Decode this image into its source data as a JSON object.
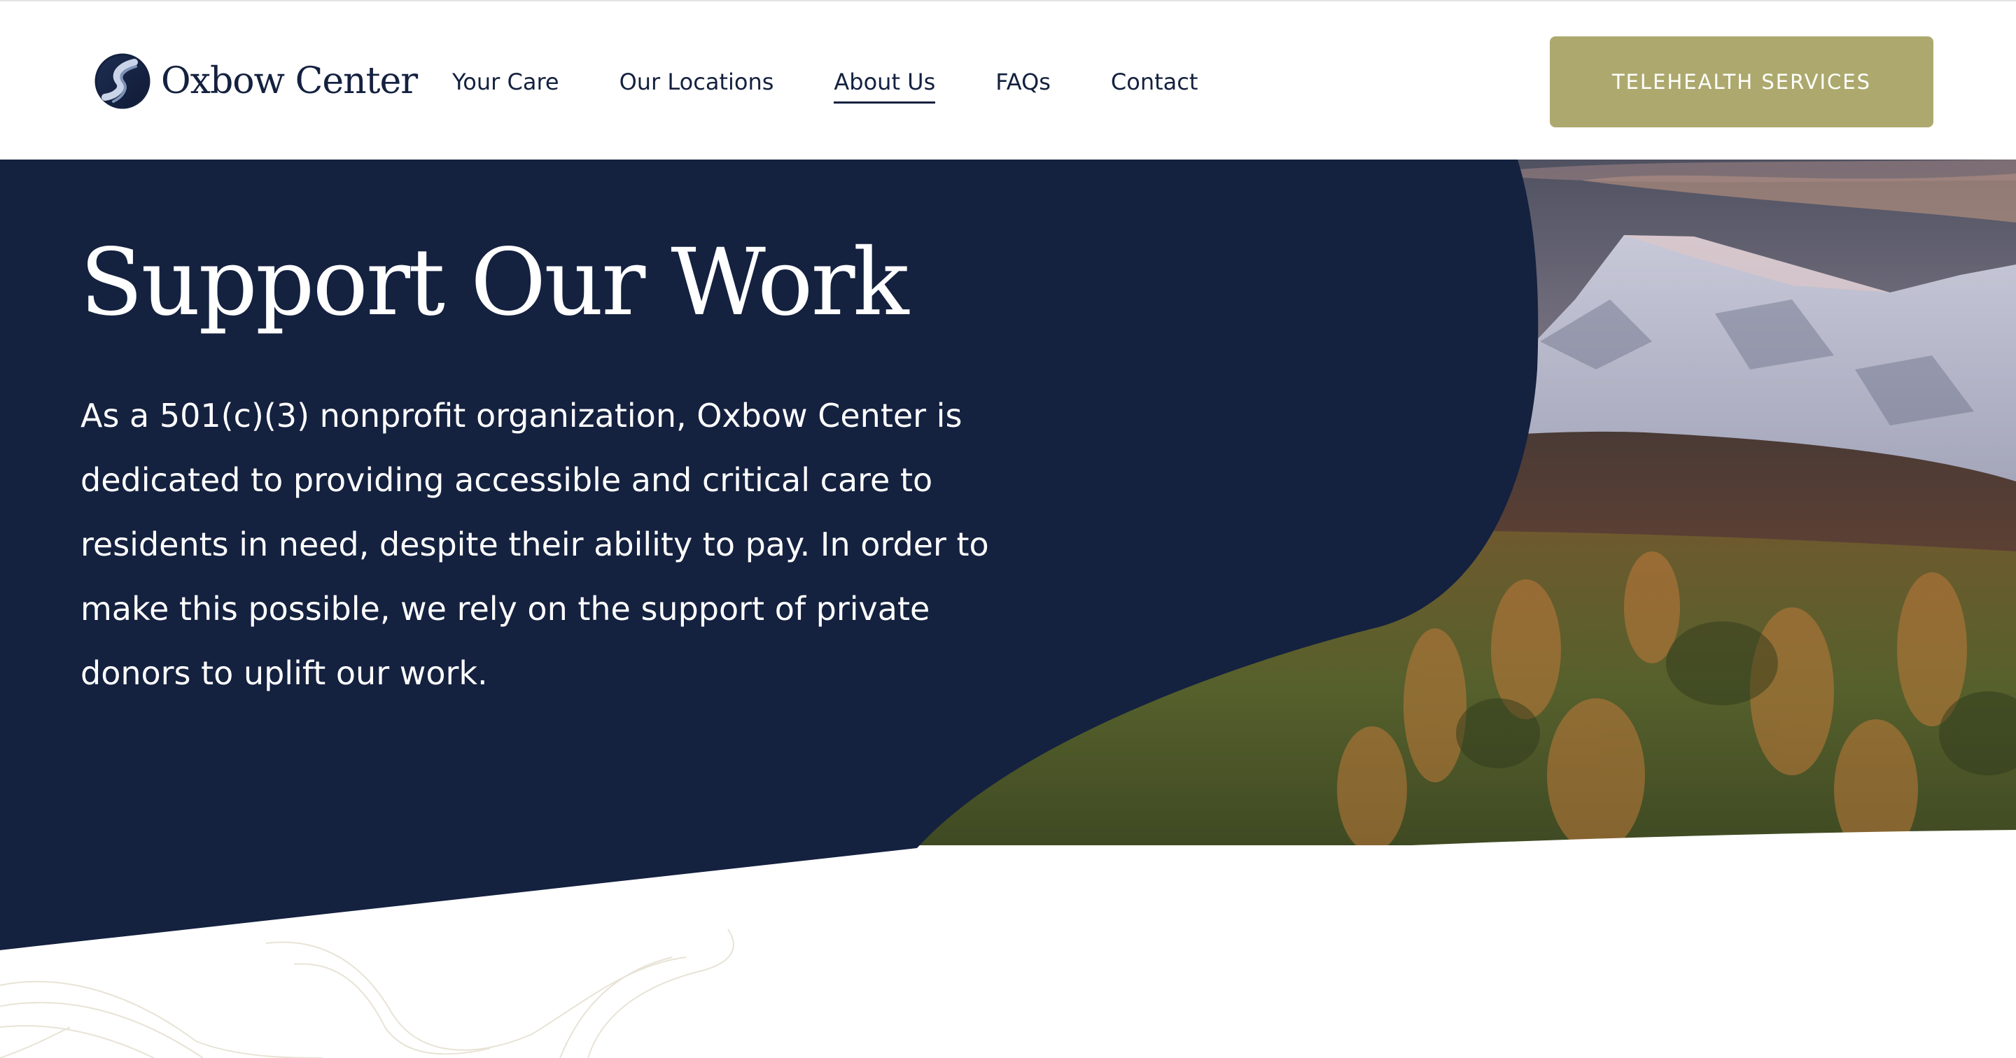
{
  "header": {
    "logo_text": "Oxbow Center",
    "nav": [
      {
        "label": "Your Care",
        "active": false
      },
      {
        "label": "Our Locations",
        "active": false
      },
      {
        "label": "About Us",
        "active": true
      },
      {
        "label": "FAQs",
        "active": false
      },
      {
        "label": "Contact",
        "active": false
      }
    ],
    "cta_label": "TELEHEALTH SERVICES"
  },
  "hero": {
    "heading": "Support Our Work",
    "body": "As a 501(c)(3) nonprofit organization, Oxbow Center is dedicated to providing accessible and critical care to residents in need, despite their ability to pay. In order to make this possible, we rely on the support of private donors to uplift our work.",
    "image_subject": "snow-capped mountain above autumn forest at dusk",
    "decoration": "topographic-line-pattern"
  },
  "colors": {
    "navy": "#14213f",
    "olive_button": "#ada96e",
    "white": "#ffffff",
    "topo_lines": "#e8e3d6"
  },
  "icons": {
    "logo": "oxbow-river-bend-icon"
  }
}
